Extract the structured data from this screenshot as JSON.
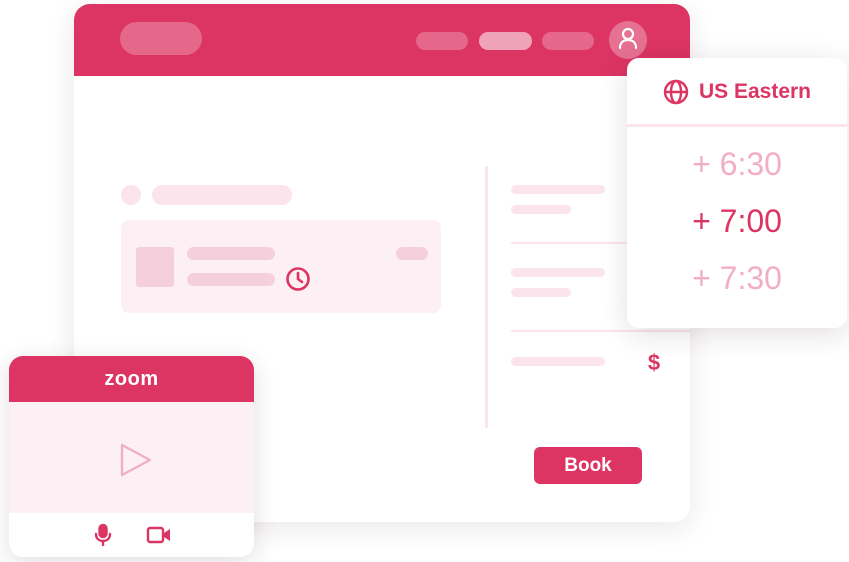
{
  "colors": {
    "accent": "#dc3463",
    "light": "#fbe4ec",
    "lighter": "#fdf0f4",
    "muted_time": "#f2aec4"
  },
  "header": {
    "profile_icon": "user-icon"
  },
  "content": {
    "clock_icon": "clock-icon",
    "price_symbol": "$"
  },
  "booking": {
    "book_label": "Book"
  },
  "timezone": {
    "icon": "globe-icon",
    "label": "US Eastern",
    "options": [
      "+ 6:30",
      "+ 7:00",
      "+ 7:30"
    ],
    "selected_index": 1
  },
  "zoom": {
    "logo_text": "zoom",
    "play_icon": "play-icon",
    "mic_icon": "microphone-icon",
    "camera_icon": "video-camera-icon"
  }
}
